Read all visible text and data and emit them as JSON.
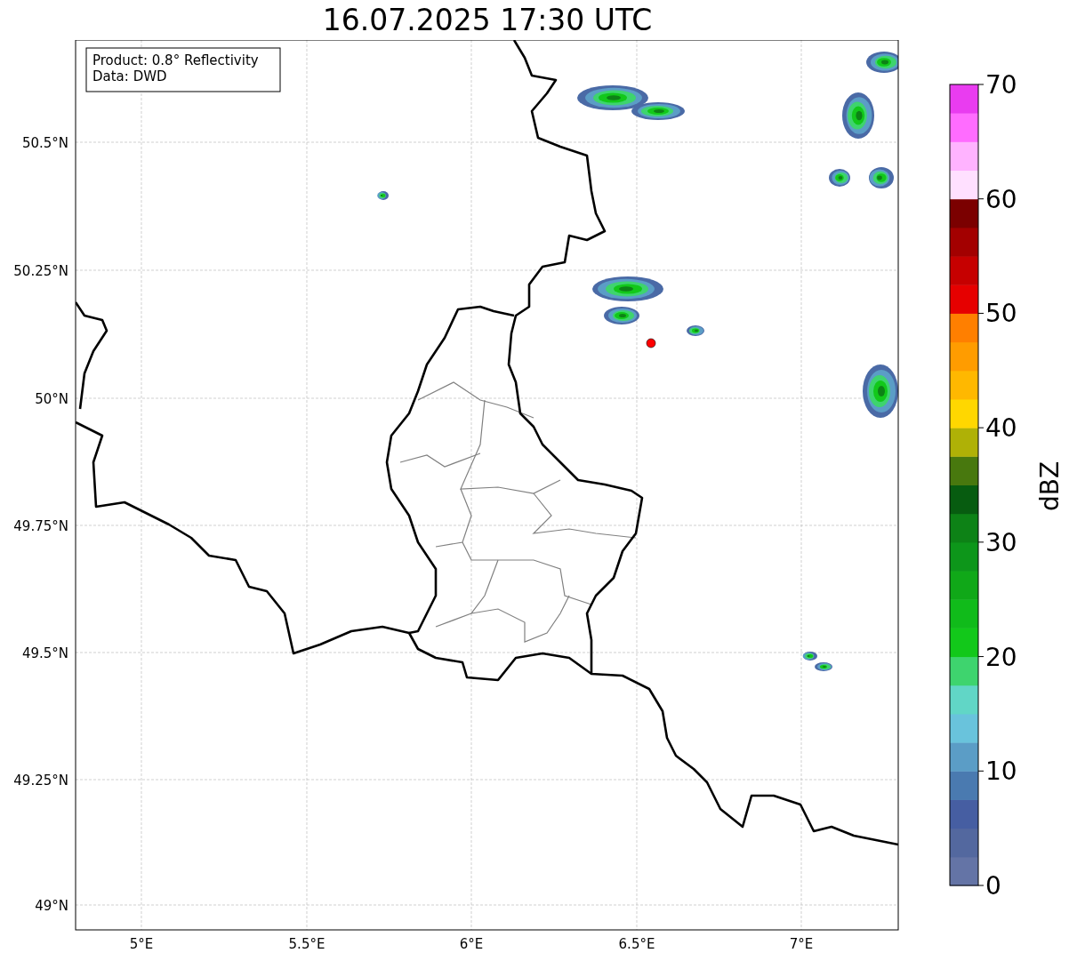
{
  "title": "16.07.2025 17:30 UTC",
  "info_box": {
    "lines": [
      "Product: 0.8° Reflectivity",
      "Data: DWD"
    ]
  },
  "y_axis": {
    "ticks": [
      "50.5°N",
      "50.25°N",
      "50°N",
      "49.75°N",
      "49.5°N",
      "49.25°N",
      "49°N"
    ]
  },
  "x_axis": {
    "ticks": [
      "5°E",
      "5.5°E",
      "6°E",
      "6.5°E",
      "7°E"
    ]
  },
  "colorbar": {
    "label": "dBZ",
    "ticks": [
      "70",
      "60",
      "50",
      "40",
      "30",
      "20",
      "10",
      "0"
    ]
  }
}
